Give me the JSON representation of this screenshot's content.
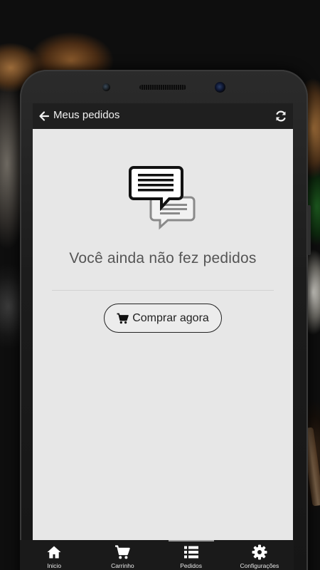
{
  "app_bar": {
    "title": "Meus pedidos",
    "back_icon": "arrow-left-icon",
    "refresh_icon": "refresh-icon"
  },
  "empty_state": {
    "icon": "chat-messages-icon",
    "message": "Você ainda não fez pedidos",
    "button_label": "Comprar agora",
    "button_icon": "shopping-cart-icon"
  },
  "bottom_nav": {
    "active": "Pedidos",
    "items": [
      {
        "label": "Inicio",
        "icon": "home-icon"
      },
      {
        "label": "Carrinho",
        "icon": "shopping-cart-icon"
      },
      {
        "label": "Pedidos",
        "icon": "list-icon"
      },
      {
        "label": "Configurações",
        "icon": "gear-icon"
      }
    ]
  },
  "colors": {
    "app_bar_bg": "#1f1f1f",
    "screen_bg": "#e7e7e7",
    "text_muted": "#555555",
    "nav_bg": "#1a1a1a"
  }
}
